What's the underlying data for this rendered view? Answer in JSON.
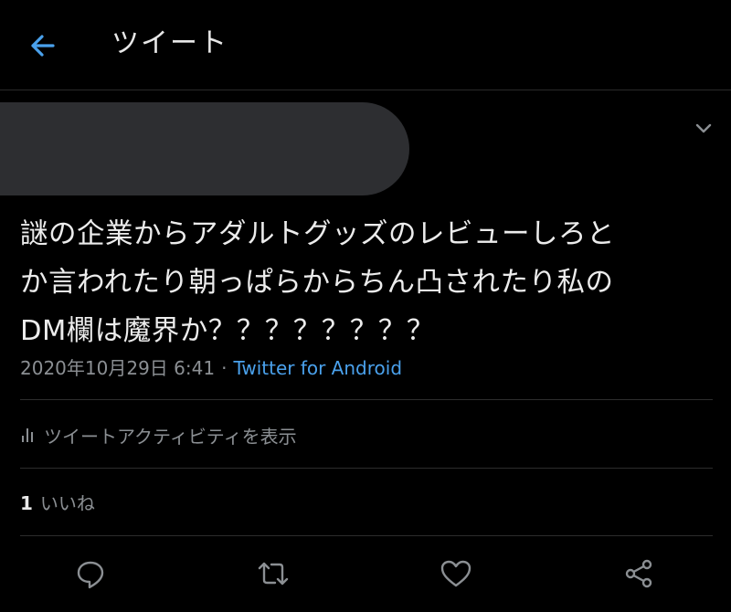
{
  "header": {
    "title": "ツイート",
    "back_icon": "arrow-left-icon"
  },
  "colors": {
    "background": "#000000",
    "accent": "#4aa1ec",
    "text_primary": "#ececec",
    "text_secondary": "#8b8f93"
  },
  "tweet": {
    "text_lines": [
      "謎の企業からアダルトグッズのレビューしろと",
      "か言われたり朝っぱらからちん凸されたり私の",
      "DM欄は魔界か？？？？？？？？"
    ],
    "timestamp": "2020年10月29日 6:41",
    "separator": "·",
    "source": "Twitter for Android",
    "menu_icon": "chevron-down-icon"
  },
  "activity": {
    "label": "ツイートアクティビティを表示",
    "icon": "bar-chart-icon"
  },
  "engagement": {
    "like_count": "1",
    "like_label": "いいね"
  },
  "actions": [
    {
      "name": "reply",
      "icon": "reply-icon"
    },
    {
      "name": "retweet",
      "icon": "retweet-icon"
    },
    {
      "name": "like",
      "icon": "heart-icon"
    },
    {
      "name": "share",
      "icon": "share-icon"
    }
  ]
}
